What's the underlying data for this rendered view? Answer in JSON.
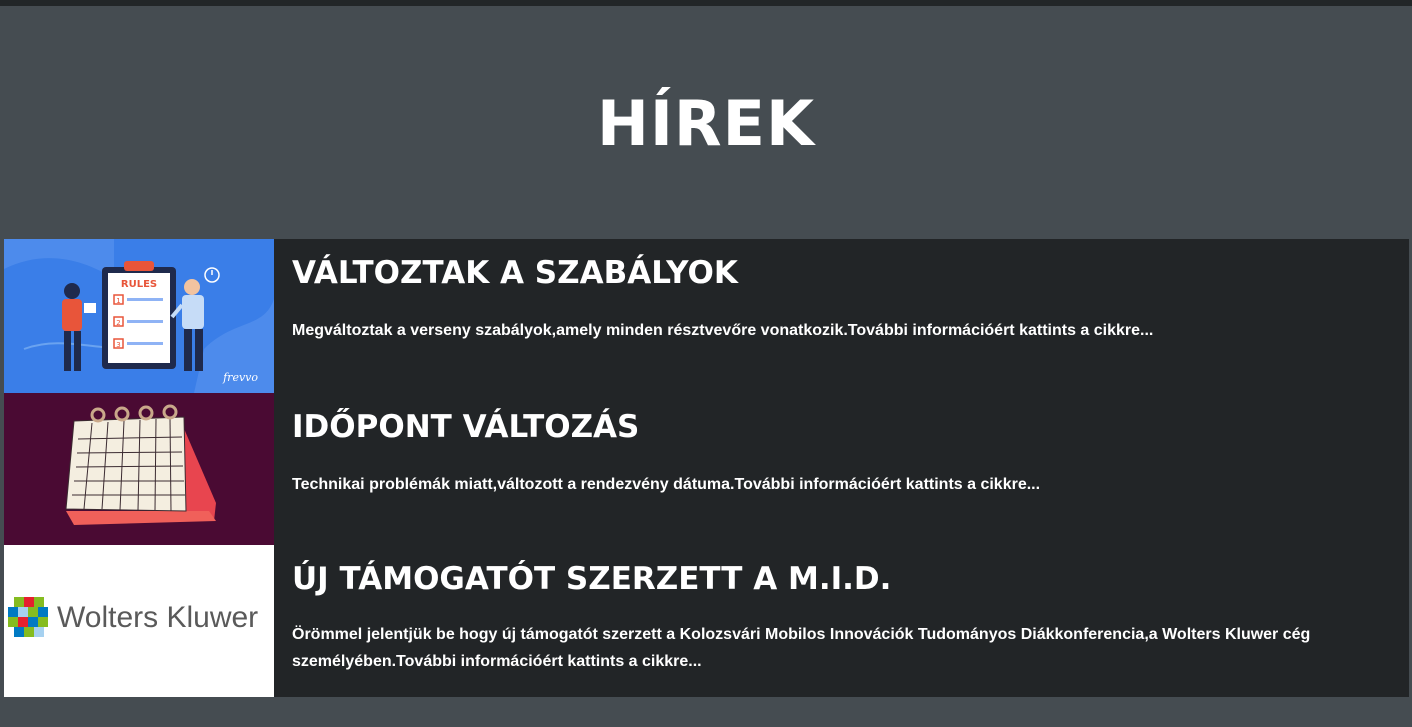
{
  "page": {
    "title": "HÍREK"
  },
  "news": [
    {
      "title": "VÁLTOZTAK A SZABÁLYOK",
      "text": "Megváltoztak a verseny szabályok,amely minden résztvevőre vonatkozik.További információért kattints a cikkre...",
      "image": {
        "icon": "rules-clipboard-illustration",
        "label": "RULES",
        "items": [
          "1",
          "2",
          "3"
        ],
        "brand": "frevvo",
        "background": "#3a7ee8"
      }
    },
    {
      "title": "IDŐPONT VÁLTOZÁS",
      "text": "Technikai problémák miatt,változott a rendezvény dátuma.További információért kattints a cikkre...",
      "image": {
        "icon": "desk-calendar-illustration",
        "background": "#4a0a33"
      }
    },
    {
      "title": "ÚJ TÁMOGATÓT SZERZETT A M.I.D.",
      "text": "Örömmel jelentjük be hogy új támogatót szerzett a Kolozsvári Mobilos Innovációk Tudományos Diákkonferencia,a Wolters Kluwer cég személyében.További információért kattints a cikkre...",
      "image": {
        "icon": "wolters-kluwer-logo",
        "logo_text": "Wolters Kluwer",
        "background": "#ffffff"
      }
    }
  ],
  "colors": {
    "page_bg": "#454c51",
    "card_bg": "#222527",
    "text": "#ffffff"
  }
}
